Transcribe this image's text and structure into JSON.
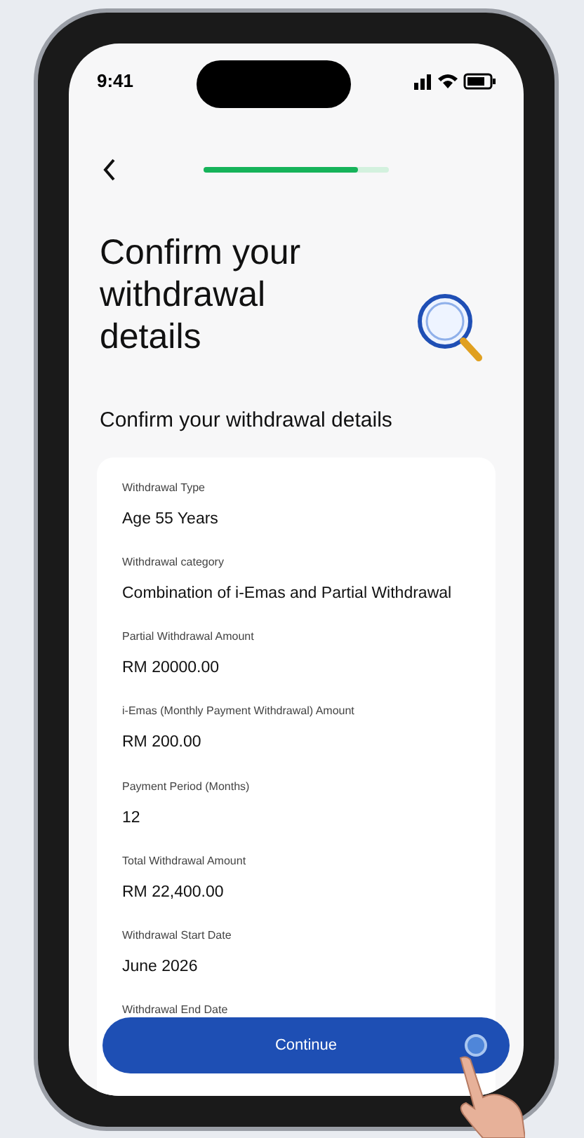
{
  "status_bar": {
    "time": "9:41"
  },
  "progress": {
    "level": 0.83
  },
  "title": "Confirm your withdrawal details",
  "section_heading": "Confirm your withdrawal details",
  "details": [
    {
      "label": "Withdrawal Type",
      "value": "Age 55 Years"
    },
    {
      "label": "Withdrawal category",
      "value": "Combination of i-Emas and Partial Withdrawal"
    },
    {
      "label": "Partial Withdrawal Amount",
      "value": "RM 20000.00"
    },
    {
      "label": "i-Emas (Monthly Payment Withdrawal) Amount",
      "value": "RM 200.00"
    },
    {
      "label": "Payment Period (Months)",
      "value": "12"
    },
    {
      "label": "Total Withdrawal Amount",
      "value": "RM 22,400.00"
    },
    {
      "label": "Withdrawal Start Date",
      "value": "June 2026"
    },
    {
      "label": "Withdrawal End Date"
    }
  ],
  "primary_button": "Continue"
}
